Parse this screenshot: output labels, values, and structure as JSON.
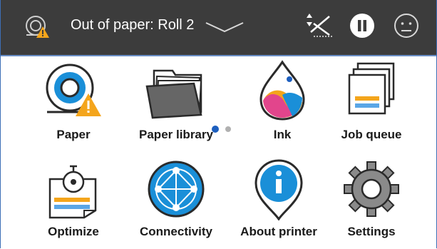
{
  "status_bar": {
    "message": "Out of paper: Roll 2",
    "icons": [
      "roll-warning-icon",
      "chevron-down-icon",
      "cutter-icon",
      "pause-icon",
      "face-icon"
    ]
  },
  "pager": {
    "pages": 2,
    "current": 1
  },
  "tiles": [
    {
      "label": "Paper",
      "icon": "paper-roll-warning-icon"
    },
    {
      "label": "Paper library",
      "icon": "folder-stack-icon"
    },
    {
      "label": "Ink",
      "icon": "ink-drop-icon"
    },
    {
      "label": "Job queue",
      "icon": "job-queue-icon"
    },
    {
      "label": "Optimize",
      "icon": "optimize-icon"
    },
    {
      "label": "Connectivity",
      "icon": "network-globe-icon"
    },
    {
      "label": "About printer",
      "icon": "info-pin-icon"
    },
    {
      "label": "Settings",
      "icon": "gear-icon"
    }
  ],
  "colors": {
    "topbar": "#3c3c3c",
    "accent_blue": "#1a8fd8",
    "warning": "#f4a51c",
    "pager_active": "#1d5fbf",
    "pager_inactive": "#b0b0b0"
  }
}
